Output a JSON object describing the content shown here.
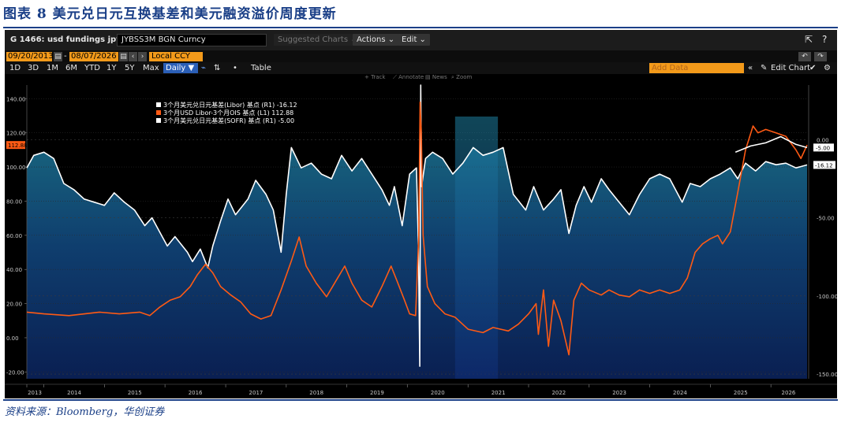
{
  "figure": {
    "title": "图表 8 美元兑日元互换基差和美元融资溢价周度更新",
    "source": "资料来源：Bloomberg，华创证券"
  },
  "terminal": {
    "ticker": "G 1466: usd fundings jpy",
    "security": "JYBSS3M BGN Curncy",
    "suggested": "Suggested Charts ⌄",
    "actions": "Actions ⌄",
    "edit": "Edit ⌄",
    "share_icon": "share-icon",
    "help_icon": "help-icon",
    "start_date": "09/20/2013",
    "end_date": "08/07/2026",
    "currency": "Local CCY",
    "periods": [
      "1D",
      "3D",
      "1M",
      "6M",
      "YTD",
      "1Y",
      "5Y",
      "Max"
    ],
    "frequency": "Daily ▼",
    "table_label": "Table",
    "add_data_placeholder": "Add Data",
    "edit_chart": "Edit Chart",
    "tools": [
      "Track",
      "Annotate",
      "News",
      "Zoom"
    ]
  },
  "colors": {
    "libor_basis": "#ffffff",
    "usd_ois_spread": "#ff5a14",
    "sofr_basis": "#ffffff",
    "area_top": "#1c7886",
    "area_bottom": "#0a1f52",
    "shade_top": "#1d7fa0",
    "accent_orange": "#f39a1a",
    "terminal_bg": "#000000"
  },
  "chart_data": {
    "type": "line",
    "x_range": [
      "2013-09-20",
      "2026-08-07"
    ],
    "x_ticks": [
      "2013",
      "2014",
      "2015",
      "2016",
      "2017",
      "2018",
      "2019",
      "2020",
      "2021",
      "2022",
      "2023",
      "2024",
      "2025",
      "2026"
    ],
    "y_left": {
      "ticks": [
        140,
        120,
        100,
        80,
        60,
        40,
        20,
        0,
        -20
      ],
      "range": [
        -24,
        148
      ],
      "tick_labels": [
        "140.00",
        "120.00",
        "100.00",
        "80.00",
        "60.00",
        "40.00",
        "20.00",
        "0.00",
        "-20.00"
      ]
    },
    "y_right": {
      "ticks": [
        0,
        -50,
        -100,
        -150
      ],
      "range": [
        -153,
        35
      ],
      "tick_labels": [
        "0.00",
        "-50.00",
        "-100.00",
        "-150.00"
      ]
    },
    "shaded_period": [
      "2020-10-15",
      "2021-06-30"
    ],
    "legend": {
      "entries": [
        "3个月美元兑日元基差(Libor) 基点 (R1) -16.12",
        "3个月USD Libor-3个月OIS 基点 (L1)    112.88",
        "3个月美元兑日元基差(SOFR) 基点 (R1) -5.00"
      ]
    },
    "last_value_labels": {
      "usd_ois_spread": "112.88",
      "sofr_basis": "-5.00",
      "libor_basis": "-16.12"
    },
    "series": [
      {
        "name": "3个月美元兑日元基差(Libor) 基点 (R1)",
        "axis": "right",
        "color": "#ffffff",
        "points": [
          [
            "2013-09-20",
            -18
          ],
          [
            "2013-11-01",
            -10
          ],
          [
            "2014-01-01",
            -8
          ],
          [
            "2014-03-01",
            -12
          ],
          [
            "2014-05-01",
            -28
          ],
          [
            "2014-07-01",
            -32
          ],
          [
            "2014-09-01",
            -38
          ],
          [
            "2014-11-01",
            -40
          ],
          [
            "2015-01-01",
            -42
          ],
          [
            "2015-03-01",
            -34
          ],
          [
            "2015-05-01",
            -40
          ],
          [
            "2015-07-01",
            -45
          ],
          [
            "2015-09-01",
            -55
          ],
          [
            "2015-10-15",
            -50
          ],
          [
            "2015-12-15",
            -62
          ],
          [
            "2016-01-15",
            -68
          ],
          [
            "2016-03-01",
            -62
          ],
          [
            "2016-05-15",
            -72
          ],
          [
            "2016-06-15",
            -78
          ],
          [
            "2016-08-01",
            -70
          ],
          [
            "2016-09-15",
            -82
          ],
          [
            "2016-10-15",
            -68
          ],
          [
            "2016-12-01",
            -52
          ],
          [
            "2017-01-15",
            -38
          ],
          [
            "2017-03-01",
            -48
          ],
          [
            "2017-05-15",
            -38
          ],
          [
            "2017-07-01",
            -26
          ],
          [
            "2017-09-01",
            -35
          ],
          [
            "2017-10-15",
            -45
          ],
          [
            "2017-12-01",
            -72
          ],
          [
            "2018-01-01",
            -35
          ],
          [
            "2018-02-01",
            -5
          ],
          [
            "2018-04-01",
            -18
          ],
          [
            "2018-06-01",
            -15
          ],
          [
            "2018-08-01",
            -22
          ],
          [
            "2018-10-01",
            -25
          ],
          [
            "2018-12-01",
            -10
          ],
          [
            "2019-02-01",
            -20
          ],
          [
            "2019-04-01",
            -12
          ],
          [
            "2019-06-01",
            -22
          ],
          [
            "2019-08-01",
            -32
          ],
          [
            "2019-09-15",
            -42
          ],
          [
            "2019-10-15",
            -30
          ],
          [
            "2019-12-01",
            -55
          ],
          [
            "2020-01-15",
            -22
          ],
          [
            "2020-02-25",
            -18
          ],
          [
            "2020-03-08",
            -70
          ],
          [
            "2020-03-16",
            -145
          ],
          [
            "2020-03-22",
            35
          ],
          [
            "2020-03-27",
            -30
          ],
          [
            "2020-04-20",
            -12
          ],
          [
            "2020-06-01",
            -8
          ],
          [
            "2020-08-01",
            -12
          ],
          [
            "2020-10-01",
            -22
          ],
          [
            "2020-12-01",
            -15
          ],
          [
            "2021-02-01",
            -5
          ],
          [
            "2021-04-01",
            -10
          ],
          [
            "2021-06-01",
            -8
          ],
          [
            "2021-08-01",
            -5
          ],
          [
            "2021-10-01",
            -35
          ],
          [
            "2021-12-15",
            -45
          ],
          [
            "2022-02-01",
            -30
          ],
          [
            "2022-04-01",
            -45
          ],
          [
            "2022-06-01",
            -38
          ],
          [
            "2022-07-15",
            -32
          ],
          [
            "2022-09-01",
            -60
          ],
          [
            "2022-10-15",
            -42
          ],
          [
            "2022-12-01",
            -30
          ],
          [
            "2023-01-15",
            -40
          ],
          [
            "2023-03-15",
            -25
          ],
          [
            "2023-05-01",
            -32
          ],
          [
            "2023-07-01",
            -40
          ],
          [
            "2023-09-01",
            -48
          ],
          [
            "2023-11-01",
            -35
          ],
          [
            "2024-01-01",
            -25
          ],
          [
            "2024-03-01",
            -22
          ],
          [
            "2024-05-01",
            -25
          ],
          [
            "2024-07-15",
            -40
          ],
          [
            "2024-09-01",
            -28
          ],
          [
            "2024-11-01",
            -30
          ],
          [
            "2025-01-01",
            -25
          ],
          [
            "2025-03-01",
            -22
          ],
          [
            "2025-05-01",
            -18
          ],
          [
            "2025-06-15",
            -25
          ],
          [
            "2025-08-01",
            -15
          ],
          [
            "2025-10-01",
            -20
          ],
          [
            "2025-12-01",
            -14
          ],
          [
            "2026-02-01",
            -16
          ],
          [
            "2026-04-01",
            -15
          ],
          [
            "2026-06-01",
            -18
          ],
          [
            "2026-08-07",
            -16.12
          ]
        ]
      },
      {
        "name": "3个月USD Libor-3个月OIS 基点 (L1)",
        "axis": "left",
        "color": "#ff5a14",
        "points": [
          [
            "2013-09-20",
            15
          ],
          [
            "2014-01-01",
            14
          ],
          [
            "2014-06-01",
            13
          ],
          [
            "2014-12-01",
            15
          ],
          [
            "2015-04-01",
            14
          ],
          [
            "2015-08-01",
            15
          ],
          [
            "2015-10-01",
            13
          ],
          [
            "2015-12-01",
            18
          ],
          [
            "2016-02-01",
            22
          ],
          [
            "2016-04-01",
            24
          ],
          [
            "2016-06-01",
            30
          ],
          [
            "2016-07-15",
            37
          ],
          [
            "2016-09-01",
            43
          ],
          [
            "2016-10-15",
            38
          ],
          [
            "2016-12-01",
            30
          ],
          [
            "2017-02-01",
            25
          ],
          [
            "2017-04-01",
            21
          ],
          [
            "2017-06-01",
            14
          ],
          [
            "2017-08-01",
            11
          ],
          [
            "2017-10-01",
            13
          ],
          [
            "2017-12-01",
            28
          ],
          [
            "2018-02-01",
            45
          ],
          [
            "2018-03-20",
            59
          ],
          [
            "2018-05-01",
            42
          ],
          [
            "2018-07-01",
            32
          ],
          [
            "2018-09-01",
            24
          ],
          [
            "2018-11-01",
            34
          ],
          [
            "2018-12-20",
            42
          ],
          [
            "2019-02-01",
            32
          ],
          [
            "2019-04-01",
            22
          ],
          [
            "2019-06-01",
            18
          ],
          [
            "2019-08-01",
            30
          ],
          [
            "2019-09-25",
            42
          ],
          [
            "2019-11-01",
            33
          ],
          [
            "2019-12-15",
            22
          ],
          [
            "2020-01-15",
            14
          ],
          [
            "2020-02-20",
            13
          ],
          [
            "2020-03-10",
            60
          ],
          [
            "2020-03-18",
            138
          ],
          [
            "2020-03-25",
            120
          ],
          [
            "2020-04-05",
            60
          ],
          [
            "2020-05-01",
            30
          ],
          [
            "2020-06-15",
            20
          ],
          [
            "2020-08-15",
            14
          ],
          [
            "2020-10-15",
            12
          ],
          [
            "2021-01-01",
            5
          ],
          [
            "2021-04-01",
            3
          ],
          [
            "2021-06-01",
            6
          ],
          [
            "2021-09-01",
            4
          ],
          [
            "2021-11-01",
            8
          ],
          [
            "2022-01-01",
            14
          ],
          [
            "2022-02-15",
            20
          ],
          [
            "2022-03-01",
            2
          ],
          [
            "2022-04-01",
            28
          ],
          [
            "2022-05-01",
            -5
          ],
          [
            "2022-06-01",
            22
          ],
          [
            "2022-07-15",
            10
          ],
          [
            "2022-09-01",
            -10
          ],
          [
            "2022-10-01",
            22
          ],
          [
            "2022-11-15",
            32
          ],
          [
            "2023-01-01",
            28
          ],
          [
            "2023-03-15",
            25
          ],
          [
            "2023-05-01",
            28
          ],
          [
            "2023-07-01",
            25
          ],
          [
            "2023-09-01",
            24
          ],
          [
            "2023-11-01",
            28
          ],
          [
            "2024-01-01",
            26
          ],
          [
            "2024-03-01",
            28
          ],
          [
            "2024-05-01",
            26
          ],
          [
            "2024-07-01",
            28
          ],
          [
            "2024-08-15",
            35
          ],
          [
            "2024-10-01",
            50
          ],
          [
            "2024-11-15",
            55
          ],
          [
            "2025-01-01",
            58
          ],
          [
            "2025-02-15",
            60
          ],
          [
            "2025-03-15",
            55
          ],
          [
            "2025-05-01",
            62
          ],
          [
            "2025-06-15",
            85
          ],
          [
            "2025-08-01",
            110
          ],
          [
            "2025-09-15",
            124
          ],
          [
            "2025-10-15",
            120
          ],
          [
            "2025-12-01",
            122
          ],
          [
            "2026-02-01",
            120
          ],
          [
            "2026-04-01",
            118
          ],
          [
            "2026-06-01",
            110
          ],
          [
            "2026-07-01",
            105
          ],
          [
            "2026-08-07",
            112.88
          ]
        ]
      },
      {
        "name": "3个月美元兑日元基差(SOFR) 基点 (R1)",
        "axis": "right",
        "color": "#ffffff",
        "points": [
          [
            "2025-06-01",
            -8
          ],
          [
            "2025-09-01",
            -4
          ],
          [
            "2025-12-01",
            -2
          ],
          [
            "2026-03-01",
            2
          ],
          [
            "2026-06-01",
            -3
          ],
          [
            "2026-08-07",
            -5.0
          ]
        ]
      }
    ]
  }
}
